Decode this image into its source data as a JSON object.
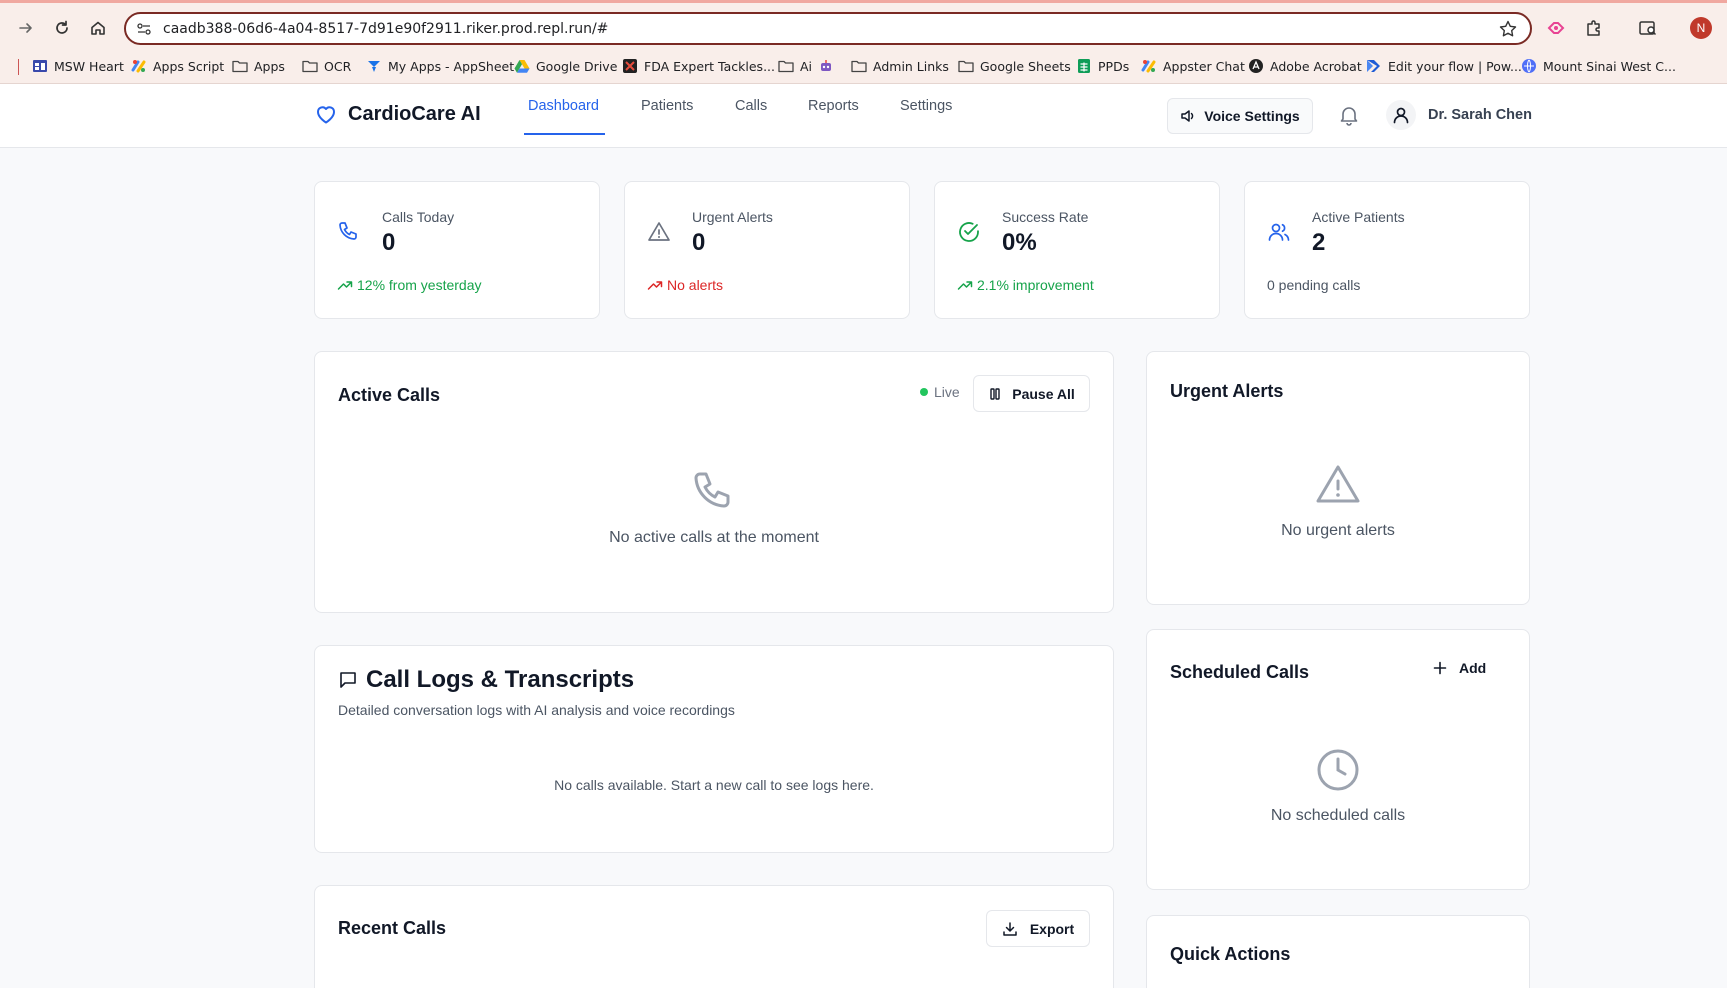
{
  "browser": {
    "url": "caadb388-06d6-4a04-8517-7d91e90f2911.riker.prod.repl.run/#",
    "profile_initial": "N",
    "bookmarks": [
      {
        "label": "MSW Heart",
        "icon": "app-grid-icon"
      },
      {
        "label": "Apps Script",
        "icon": "apps-script-icon"
      },
      {
        "label": "Apps",
        "icon": "folder-icon"
      },
      {
        "label": "OCR",
        "icon": "folder-icon"
      },
      {
        "label": "My Apps - AppSheet",
        "icon": "appsheet-icon"
      },
      {
        "label": "Google Drive",
        "icon": "drive-icon"
      },
      {
        "label": "FDA Expert Tackles...",
        "icon": "fda-icon"
      },
      {
        "label": "Ai",
        "icon": "folder-icon"
      },
      {
        "label": "Admin Links",
        "icon": "folder-icon"
      },
      {
        "label": "Google Sheets",
        "icon": "folder-icon"
      },
      {
        "label": "PPDs",
        "icon": "sheets-icon"
      },
      {
        "label": "Appster Chat",
        "icon": "apps-script-icon"
      },
      {
        "label": "Adobe Acrobat",
        "icon": "acrobat-icon"
      },
      {
        "label": "Edit your flow | Pow...",
        "icon": "power-automate-icon"
      },
      {
        "label": "Mount Sinai West C...",
        "icon": "globe-icon"
      }
    ]
  },
  "app": {
    "brand": "CardioCare AI",
    "nav": [
      "Dashboard",
      "Patients",
      "Calls",
      "Reports",
      "Settings"
    ],
    "active_tab": "Dashboard",
    "voice_settings_label": "Voice Settings",
    "user_name": "Dr. Sarah Chen"
  },
  "stats": [
    {
      "label": "Calls Today",
      "value": "0",
      "sub": "12% from yesterday",
      "icon": "phone-icon",
      "tone": "green"
    },
    {
      "label": "Urgent Alerts",
      "value": "0",
      "sub": "No alerts",
      "icon": "alert-triangle-icon",
      "tone": "red"
    },
    {
      "label": "Success Rate",
      "value": "0%",
      "sub": "2.1% improvement",
      "icon": "check-circle-icon",
      "tone": "green"
    },
    {
      "label": "Active Patients",
      "value": "2",
      "sub": "0 pending calls",
      "icon": "users-icon",
      "tone": "gray"
    }
  ],
  "active_calls": {
    "title": "Active Calls",
    "live_label": "Live",
    "pause_label": "Pause All",
    "empty": "No active calls at the moment"
  },
  "urgent_alerts": {
    "title": "Urgent Alerts",
    "empty": "No urgent alerts"
  },
  "call_logs": {
    "title": "Call Logs & Transcripts",
    "subtitle": "Detailed conversation logs with AI analysis and voice recordings",
    "empty": "No calls available. Start a new call to see logs here."
  },
  "scheduled_calls": {
    "title": "Scheduled Calls",
    "add_label": "Add",
    "empty": "No scheduled calls"
  },
  "recent_calls": {
    "title": "Recent Calls",
    "export_label": "Export"
  },
  "quick_actions": {
    "title": "Quick Actions"
  },
  "colors": {
    "accent": "#2563eb",
    "success": "#16a34a",
    "danger": "#dc2626"
  }
}
